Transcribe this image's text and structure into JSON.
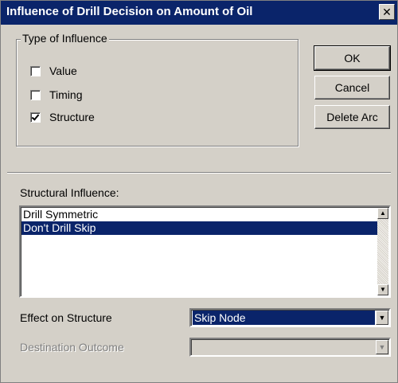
{
  "window": {
    "title": "Influence of Drill Decision on Amount of Oil",
    "close_glyph": "✕"
  },
  "type_of_influence": {
    "legend": "Type of Influence",
    "options": [
      {
        "label": "Value",
        "checked": false
      },
      {
        "label": "Timing",
        "checked": false
      },
      {
        "label": "Structure",
        "checked": true
      }
    ]
  },
  "buttons": {
    "ok": "OK",
    "cancel": "Cancel",
    "delete_arc": "Delete Arc"
  },
  "structural_influence": {
    "label": "Structural Influence:",
    "items": [
      {
        "label": "Drill Symmetric",
        "selected": false
      },
      {
        "label": "Don't Drill Skip",
        "selected": true
      }
    ]
  },
  "effect_on_structure": {
    "label": "Effect on Structure",
    "value": "Skip Node"
  },
  "destination_outcome": {
    "label": "Destination Outcome",
    "value": "",
    "enabled": false
  },
  "colors": {
    "titlebar": "#0a246a",
    "face": "#d4d0c8",
    "selection": "#0a246a"
  },
  "icons": {
    "scroll_up": "▲",
    "scroll_down": "▼",
    "dropdown": "▼"
  }
}
